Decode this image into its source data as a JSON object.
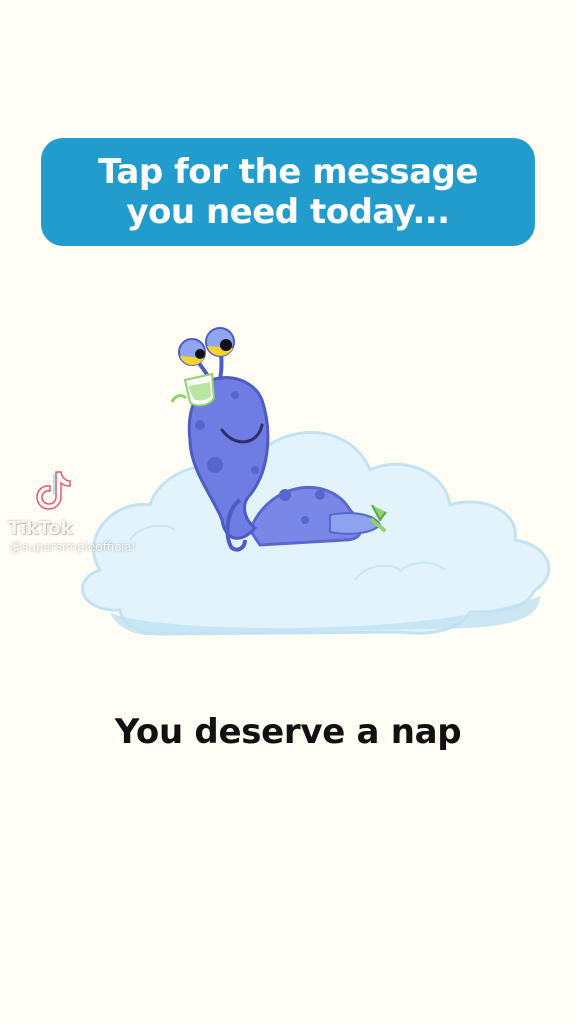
{
  "prompt": {
    "text": "Tap for the message you need today..."
  },
  "message": {
    "text": "You deserve a nap"
  },
  "watermark": {
    "brand": "TikTok",
    "handle": "@supersimpleofficial",
    "logo_icon": "tiktok-logo-icon"
  },
  "illustration": {
    "subject": "snail-character",
    "props": [
      "cloud",
      "tea-cup"
    ]
  },
  "colors": {
    "background": "#fffdf4",
    "banner": "#219ccd",
    "banner_text": "#ffffff",
    "cloud": "#dff0f8",
    "character": "#6b7fe0",
    "message_text": "#111111"
  }
}
